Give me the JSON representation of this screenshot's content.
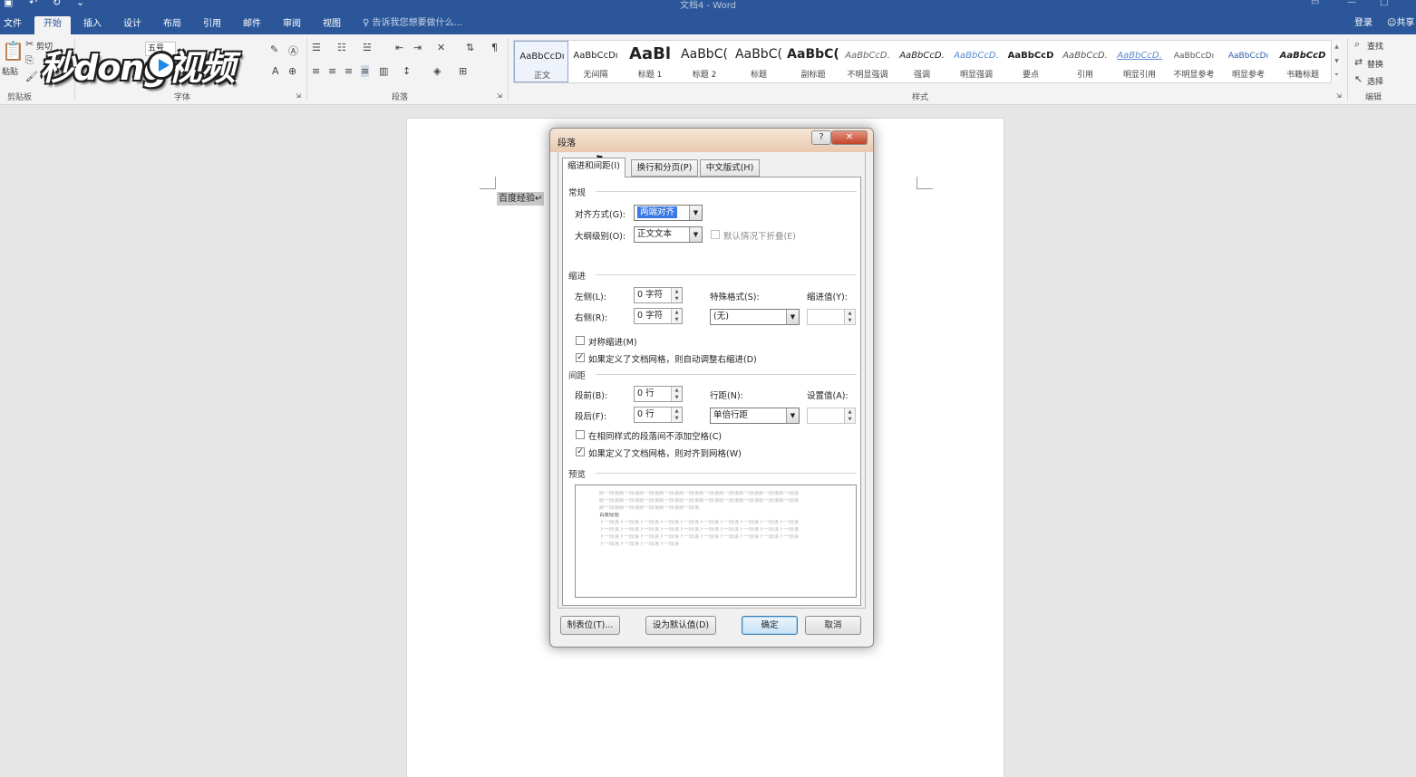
{
  "titlebar": {
    "title": "文档4 - Word",
    "quick_access": [
      "保存",
      "撤销",
      "重做",
      "自定义"
    ]
  },
  "ribbon_tabs": [
    {
      "label": "文件"
    },
    {
      "label": "开始"
    },
    {
      "label": "插入"
    },
    {
      "label": "设计"
    },
    {
      "label": "布局"
    },
    {
      "label": "引用"
    },
    {
      "label": "邮件"
    },
    {
      "label": "审阅"
    },
    {
      "label": "视图"
    }
  ],
  "tell_me": "告诉我您想要做什么...",
  "sign_in": "登录",
  "share": "共享",
  "ribbon": {
    "clipboard": {
      "paste": "粘贴",
      "cut": "剪切",
      "group": "剪贴板"
    },
    "font": {
      "size": "五号",
      "group": "字体"
    },
    "paragraph": {
      "group": "段落"
    },
    "styles": {
      "group": "样式",
      "items": [
        {
          "preview": "AaBbCcDı",
          "name": "正文",
          "selected": true
        },
        {
          "preview": "AaBbCcDı",
          "name": "无间隔"
        },
        {
          "preview": "AaBl",
          "name": "标题 1"
        },
        {
          "preview": "AaBbC(",
          "name": "标题 2"
        },
        {
          "preview": "AaBbC(",
          "name": "标题"
        },
        {
          "preview": "AaBbC(",
          "name": "副标题"
        },
        {
          "preview": "AaBbCcD.",
          "name": "不明显强调"
        },
        {
          "preview": "AaBbCcD.",
          "name": "强调"
        },
        {
          "preview": "AaBbCcD.",
          "name": "明显强调"
        },
        {
          "preview": "AaBbCcD",
          "name": "要点"
        },
        {
          "preview": "AaBbCcD.",
          "name": "引用"
        },
        {
          "preview": "AaBbCcD.",
          "name": "明显引用"
        },
        {
          "preview": "AaBbCcDı",
          "name": "不明显参考"
        },
        {
          "preview": "AaBbCcDı",
          "name": "明显参考"
        },
        {
          "preview": "AaBbCcD",
          "name": "书籍标题"
        }
      ]
    },
    "editing": {
      "find": "查找",
      "replace": "替换",
      "select": "选择",
      "group": "编辑"
    }
  },
  "watermark": "秒dong视频",
  "document": {
    "text": "百度经验↵"
  },
  "dialog": {
    "title": "段落",
    "help": "?",
    "close": "✕",
    "tabs": [
      {
        "label": "缩进和间距(I)",
        "active": true
      },
      {
        "label": "换行和分页(P)"
      },
      {
        "label": "中文版式(H)"
      }
    ],
    "general": {
      "heading": "常规",
      "alignment_label": "对齐方式(G):",
      "alignment_value": "两端对齐",
      "outline_label": "大纲级别(O):",
      "outline_value": "正文文本",
      "collapsed_label": "默认情况下折叠(E)"
    },
    "indent": {
      "heading": "缩进",
      "left_label": "左侧(L):",
      "left_value": "0 字符",
      "right_label": "右侧(R):",
      "right_value": "0 字符",
      "special_label": "特殊格式(S):",
      "special_value": "(无)",
      "by_label": "缩进值(Y):",
      "mirror_label": "对称缩进(M)",
      "auto_adjust_label": "如果定义了文档网格，则自动调整右缩进(D)"
    },
    "spacing": {
      "heading": "间距",
      "before_label": "段前(B):",
      "before_value": "0 行",
      "after_label": "段后(F):",
      "after_value": "0 行",
      "line_label": "行距(N):",
      "line_value": "单倍行距",
      "at_label": "设置值(A):",
      "no_space_label": "在相同样式的段落间不添加空格(C)",
      "snap_grid_label": "如果定义了文档网格，则对齐到网格(W)"
    },
    "preview": {
      "heading": "预览",
      "lines": [
        "前一段落前一段落前一段落前一段落前一段落前一段落前一段落前一段落前一段落前一段落",
        "前一段落前一段落前一段落前一段落前一段落前一段落前一段落前一段落前一段落前一段落",
        "前一段落前一段落前一段落前一段落前一段落",
        "百度经验",
        "下一段落下一段落下一段落下一段落下一段落下一段落下一段落下一段落下一段落下一段落",
        "下一段落下一段落下一段落下一段落下一段落下一段落下一段落下一段落下一段落下一段落",
        "下一段落下一段落下一段落下一段落下一段落下一段落下一段落下一段落下一段落下一段落",
        "下一段落下一段落下一段落下一段落"
      ]
    },
    "buttons": {
      "tabs": "制表位(T)...",
      "set_default": "设为默认值(D)",
      "ok": "确定",
      "cancel": "取消"
    }
  }
}
